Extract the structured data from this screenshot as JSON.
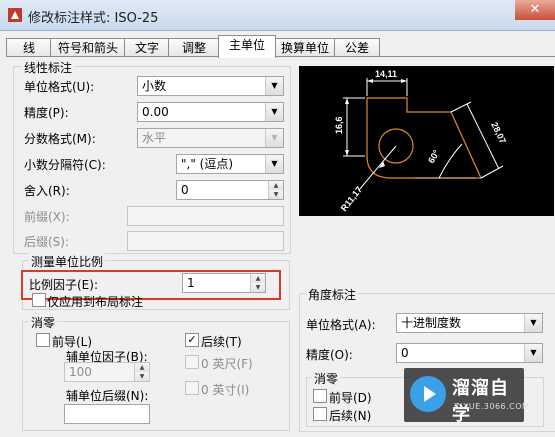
{
  "window": {
    "title": "修改标注样式: ISO-25",
    "close_glyph": "✕"
  },
  "tabs": [
    {
      "label": "线"
    },
    {
      "label": "符号和箭头"
    },
    {
      "label": "文字"
    },
    {
      "label": "调整"
    },
    {
      "label": "主单位",
      "active": true
    },
    {
      "label": "换算单位"
    },
    {
      "label": "公差"
    }
  ],
  "linear": {
    "title": "线性标注",
    "unit_format": {
      "label": "单位格式(U):",
      "value": "小数"
    },
    "precision": {
      "label": "精度(P):",
      "value": "0.00"
    },
    "fraction_format": {
      "label": "分数格式(M):",
      "value": "水平"
    },
    "decimal_separator": {
      "label": "小数分隔符(C):",
      "value": "\",\"  (逗点)"
    },
    "round_off": {
      "label": "舍入(R):",
      "value": "0"
    },
    "prefix": {
      "label": "前缀(X):",
      "value": ""
    },
    "suffix": {
      "label": "后缀(S):",
      "value": ""
    }
  },
  "measurement_scale": {
    "title": "测量单位比例",
    "scale_factor": {
      "label": "比例因子(E):",
      "value": "1"
    },
    "layout_only": {
      "label": "仅应用到布局标注",
      "checked": false
    }
  },
  "zero_suppression": {
    "title": "消零",
    "leading": {
      "label": "前导(L)",
      "checked": false
    },
    "trailing": {
      "label": "后续(T)",
      "checked": true
    },
    "sub_factor": {
      "label": "辅单位因子(B):",
      "value": "100"
    },
    "feet": {
      "label": "0 英尺(F)",
      "checked": false
    },
    "inches": {
      "label": "0 英寸(I)",
      "checked": false
    },
    "sub_suffix": {
      "label": "辅单位后缀(N):",
      "value": ""
    }
  },
  "angular": {
    "title": "角度标注",
    "unit_format": {
      "label": "单位格式(A):",
      "value": "十进制度数"
    },
    "precision": {
      "label": "精度(O):",
      "value": "0"
    },
    "zero": {
      "title": "消零",
      "leading": {
        "label": "前导(D)",
        "checked": false
      },
      "trailing": {
        "label": "后续(N)",
        "checked": false
      }
    }
  },
  "preview": {
    "dim_top": "14,11",
    "dim_left": "16,6",
    "dim_right": "28,07",
    "dim_angle": "60°",
    "dim_radius": "R11,17",
    "colors": {
      "background": "#000000",
      "geometry": "#e08a2a",
      "dimension": "#ffffff"
    }
  },
  "watermark": {
    "name": "溜溜自学",
    "url": "ZIXUE.3066.COM"
  }
}
